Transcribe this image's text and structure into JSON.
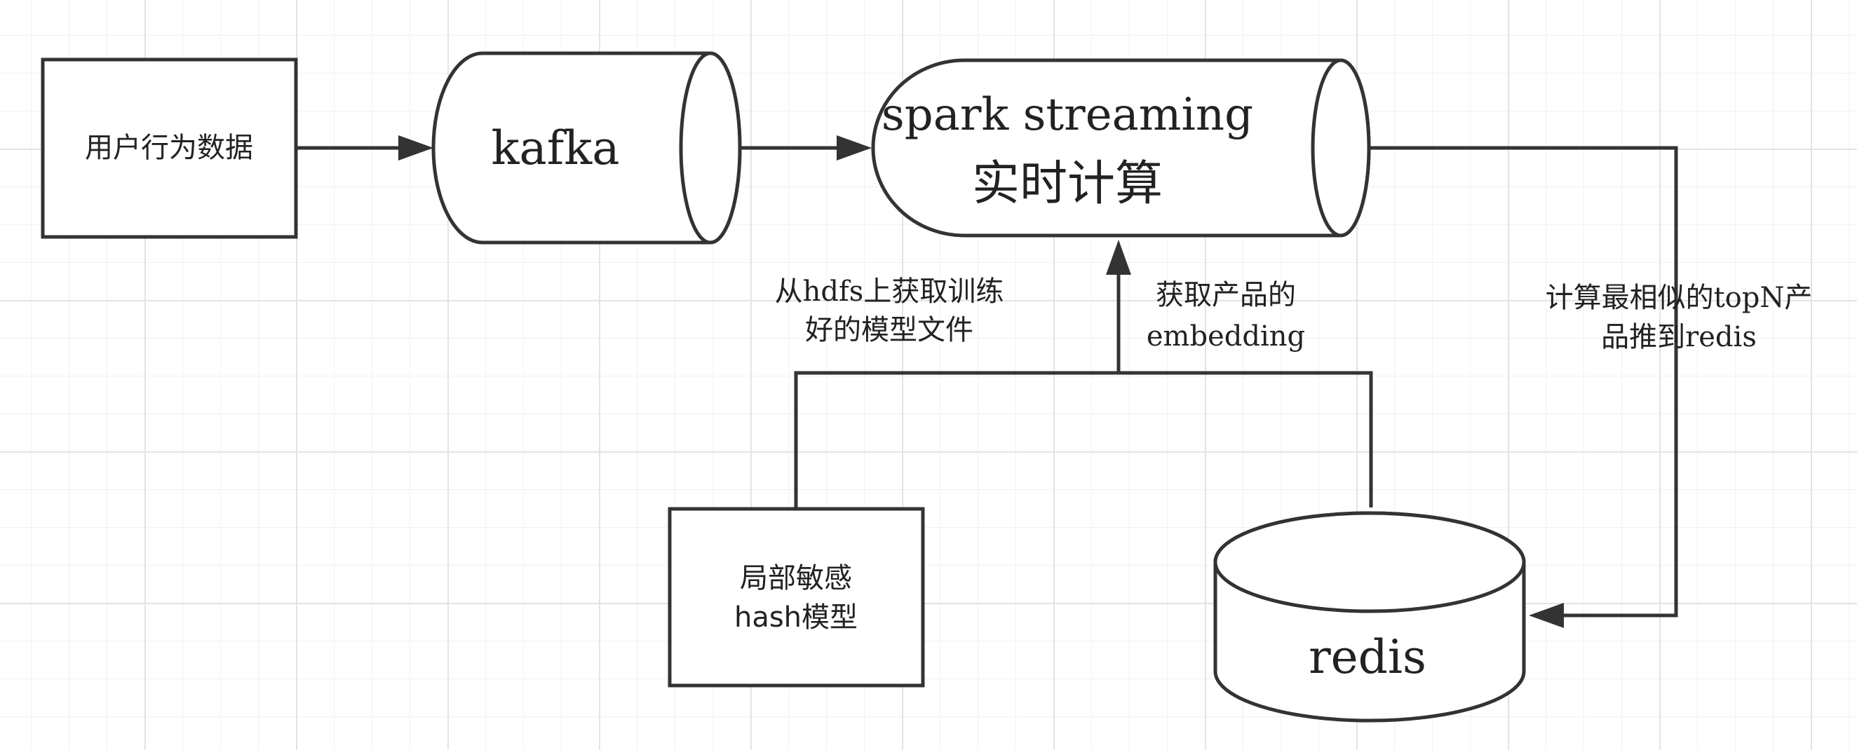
{
  "nodes": {
    "user_data": {
      "label": "用户行为数据"
    },
    "kafka": {
      "label": "kafka"
    },
    "spark": {
      "label_line1": "spark streaming",
      "label_line2": "实时计算"
    },
    "lsh": {
      "label_line1": "局部敏感",
      "label_line2": "hash模型"
    },
    "redis": {
      "label": "redis"
    }
  },
  "edge_labels": {
    "hdfs_line1": "从hdfs上获取训练",
    "hdfs_line2": "好的模型文件",
    "embedding_line1": "获取产品的",
    "embedding_line2": "embedding",
    "topn_line1": "计算最相似的topN产",
    "topn_line2": "品推到redis"
  }
}
